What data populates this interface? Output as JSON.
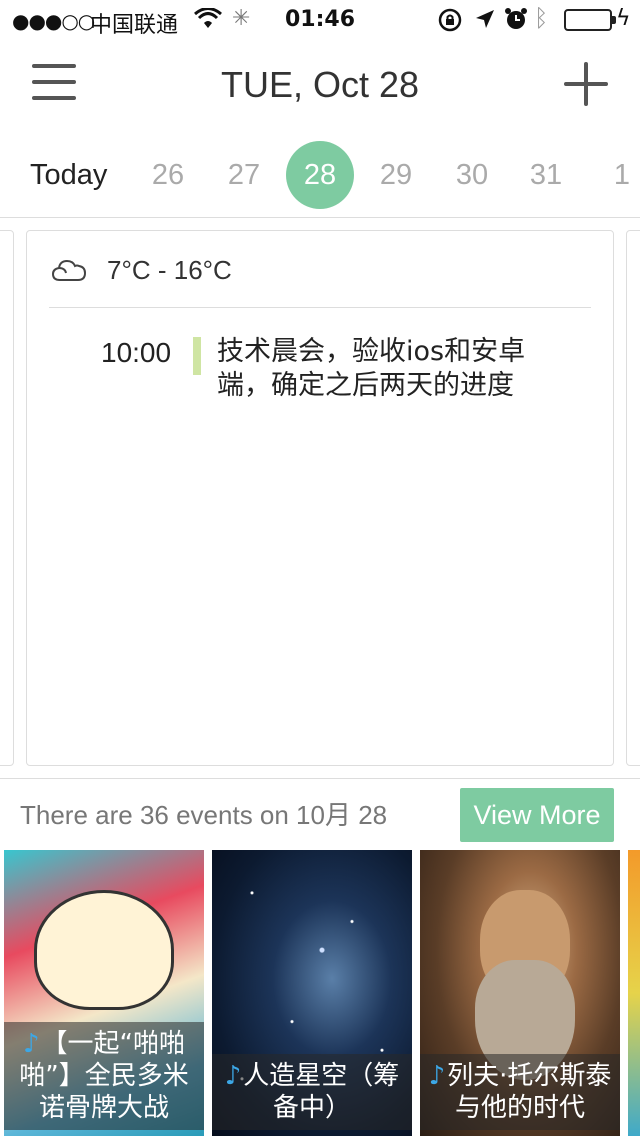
{
  "status_bar": {
    "signal": "●●●○○",
    "carrier": "中国联通",
    "time": "01:46"
  },
  "nav": {
    "title": "TUE, Oct 28"
  },
  "date_strip": {
    "today_label": "Today",
    "days": [
      "26",
      "27",
      "28",
      "29",
      "30",
      "31",
      "1"
    ],
    "selected": "28"
  },
  "day_card": {
    "weather": {
      "icon": "cloud-icon",
      "range": "7°C - 16°C"
    },
    "events": [
      {
        "time": "10:00",
        "title": "技术晨会，验收ios和安卓端，确定之后两天的进度",
        "color": "#cfe5a3"
      }
    ]
  },
  "summary": {
    "count_text": "There are 36 events on 10月 28",
    "view_more_label": "View More"
  },
  "thumbnails": [
    {
      "title": "【一起“啪啪啪”】全民多米诺骨牌大战",
      "icon": "music-note-icon"
    },
    {
      "title": "人造星空（筹备中）",
      "icon": "music-note-icon"
    },
    {
      "title": "列夫·托尔斯泰与他的时代",
      "icon": "music-note-icon"
    }
  ],
  "colors": {
    "accent": "#7ecba1",
    "battery": "#4cd964"
  }
}
